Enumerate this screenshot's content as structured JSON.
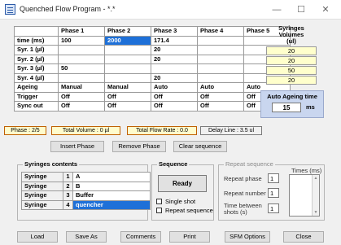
{
  "window": {
    "title": "Quenched Flow Program - *.*",
    "minimize": "—",
    "maximize": "☐",
    "close": "✕"
  },
  "phase_table": {
    "columns": [
      "",
      "Phase 1",
      "Phase 2",
      "Phase 3",
      "Phase 4",
      "Phase 5"
    ],
    "rows": [
      {
        "label": "time (ms)",
        "cells": [
          "100",
          "2000",
          "171.4",
          "",
          ""
        ]
      },
      {
        "label": "Syr. 1 (µl)",
        "cells": [
          "",
          "",
          "20",
          "",
          ""
        ]
      },
      {
        "label": "Syr. 2 (µl)",
        "cells": [
          "",
          "",
          "20",
          "",
          ""
        ]
      },
      {
        "label": "Syr. 3 (µl)",
        "cells": [
          "50",
          "",
          "",
          "",
          ""
        ]
      },
      {
        "label": "Syr. 4 (µl)",
        "cells": [
          "",
          "",
          "20",
          "",
          ""
        ]
      },
      {
        "label": "Ageing",
        "cells": [
          "Manual",
          "Manual",
          "Auto",
          "Auto",
          "Auto"
        ]
      },
      {
        "label": "Trigger",
        "cells": [
          "Off",
          "Off",
          "Off",
          "Off",
          "Off"
        ]
      },
      {
        "label": "Sync out",
        "cells": [
          "Off",
          "Off",
          "Off",
          "Off",
          "Off"
        ]
      }
    ],
    "selected_cell": "time-phase-2"
  },
  "syringe_volumes": {
    "title_line1": "Syringes",
    "title_line2": "Volumes",
    "title_line3": "(ul)",
    "values": [
      "20",
      "20",
      "50",
      "20"
    ]
  },
  "auto_ageing": {
    "title": "Auto Ageing time",
    "value": "15",
    "unit": "ms"
  },
  "status": {
    "phase": "Phase : 2/5",
    "total_volume": "Total Volume : 0 µl",
    "total_flow": "Total Flow Rate : 0.0",
    "delay_line": "Delay Line : 3.5 ul"
  },
  "phase_buttons": {
    "insert": "Insert Phase",
    "remove": "Remove Phase",
    "clear": "Clear sequence"
  },
  "syringes_contents": {
    "title": "Syringes contents",
    "items": [
      {
        "label": "Syringe",
        "num": "1",
        "value": "A"
      },
      {
        "label": "Syringe",
        "num": "2",
        "value": "B"
      },
      {
        "label": "Syringe",
        "num": "3",
        "value": "Buffer"
      },
      {
        "label": "Syringe",
        "num": "4",
        "value": "quencher"
      }
    ]
  },
  "sequence": {
    "title": "Sequence",
    "ready": "Ready",
    "single_shot": "Single shot",
    "repeat_sequence": "Repeat sequence"
  },
  "repeat_sequence": {
    "title": "Repeat sequence",
    "repeat_phase_label": "Repeat phase",
    "repeat_phase_value": "1",
    "repeat_number_label": "Repeat number",
    "repeat_number_value": "1",
    "time_between_line1": "Time between",
    "time_between_line2": "shots (s)",
    "time_between_value": "1",
    "times_label": "Times (ms)"
  },
  "footer": {
    "load": "Load",
    "save_as": "Save As",
    "comments": "Comments",
    "print": "Print",
    "sfm_options": "SFM Options",
    "close": "Close"
  }
}
